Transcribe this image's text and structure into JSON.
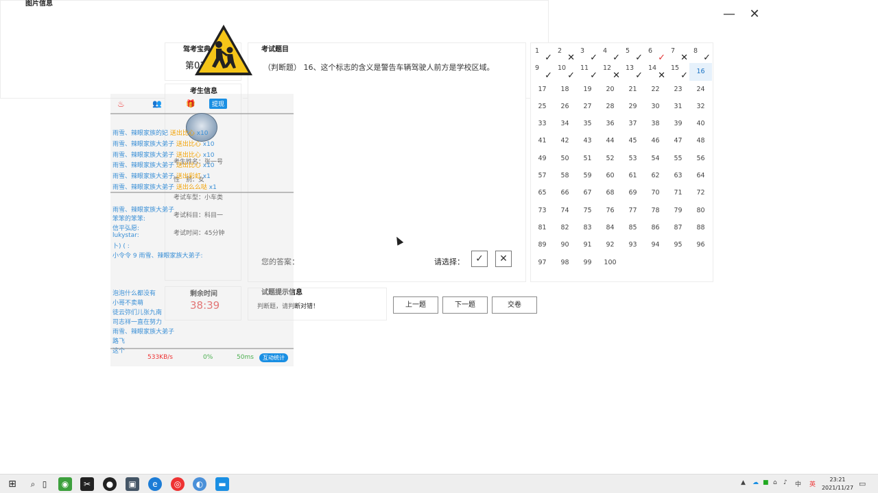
{
  "window": {
    "minimize_glyph": "—",
    "close_glyph": "✕"
  },
  "exam": {
    "venue_title": "驾考宝典考场",
    "seat": "第01考台",
    "student_info_title": "考生信息",
    "student_name_label": "考生姓名：",
    "student_name": "张一号",
    "gender_label": "性　别：",
    "gender": "女",
    "car_type_label": "考试车型：",
    "car_type": "小车类",
    "subject_label": "考试科目：",
    "subject": "科目一",
    "duration_label": "考试时间：",
    "duration": "45分钟",
    "remaining_title": "剩余时间",
    "remaining": "38:39"
  },
  "question": {
    "panel_title": "考试题目",
    "text": "（判断题） 16、这个标志的含义是警告车辆驾驶人前方是学校区域。",
    "your_answer_label": "您的答案：",
    "choose_label": "请选择：",
    "true_glyph": "✓",
    "false_glyph": "✕"
  },
  "hint": {
    "panel_title": "试题提示信息",
    "text": "判断题，请判断对错！"
  },
  "buttons": {
    "prev": "上一题",
    "next": "下一题",
    "submit": "交卷"
  },
  "image_panel": {
    "title": "图片信息",
    "sign": "school-zone-warning-sign"
  },
  "grid": {
    "answered": [
      {
        "n": "1",
        "mark": "✓",
        "color": "#222222"
      },
      {
        "n": "2",
        "mark": "✕",
        "color": "#222222"
      },
      {
        "n": "3",
        "mark": "✓",
        "color": "#222222"
      },
      {
        "n": "4",
        "mark": "✓",
        "color": "#222222"
      },
      {
        "n": "5",
        "mark": "✓",
        "color": "#222222"
      },
      {
        "n": "6",
        "mark": "✓",
        "color": "#e33333"
      },
      {
        "n": "7",
        "mark": "✕",
        "color": "#222222"
      },
      {
        "n": "8",
        "mark": "✓",
        "color": "#222222"
      },
      {
        "n": "9",
        "mark": "✓",
        "color": "#222222"
      },
      {
        "n": "10",
        "mark": "✓",
        "color": "#222222"
      },
      {
        "n": "11",
        "mark": "✓",
        "color": "#222222"
      },
      {
        "n": "12",
        "mark": "✕",
        "color": "#222222"
      },
      {
        "n": "13",
        "mark": "✓",
        "color": "#222222"
      },
      {
        "n": "14",
        "mark": "✕",
        "color": "#222222"
      },
      {
        "n": "15",
        "mark": "✓",
        "color": "#222222"
      }
    ],
    "current": "16",
    "total": 100
  },
  "overlay": {
    "toolbar_withdraw": "提现",
    "gift_lines": [
      {
        "user": "雨雪、辣眼家族的妃",
        "gift": "送出比心",
        "count": "x10"
      },
      {
        "user": "雨雪、辣眼家族大弟子",
        "gift": "送出比心",
        "count": "x10"
      },
      {
        "user": "雨雪、辣眼家族大弟子",
        "gift": "送出比心",
        "count": "x10"
      },
      {
        "user": "雨雪、辣眼家族大弟子",
        "gift": "送出比心",
        "count": "x10"
      },
      {
        "user": "雨雪、辣眼家族大弟子",
        "gift": "送出彩虹",
        "count": "x1"
      },
      {
        "user": "雨雪、辣眼家族大弟子",
        "gift": "送出么么哒",
        "count": "x1"
      }
    ],
    "chat_lines": [
      "雨雪、辣眼家族大弟子",
      "笨笨的笨笨:",
      "信平弘愿:",
      "lukystar:",
      "卜) ( :",
      "小令令  9  雨雪、辣眼家族大弟子:"
    ],
    "chat_lines_2": [
      "泡泡什么都没有",
      "小哥不卖萌",
      "徒云弥们儿张九南",
      "司志祥一直在努力",
      "雨雪、辣眼家族大弟子",
      "路飞",
      "这个"
    ],
    "stats": {
      "speed": "533KB/s",
      "loss": "0%",
      "ping": "50ms",
      "button": "互动统计"
    }
  },
  "taskbar": {
    "clock_time": "23:21",
    "clock_date": "2021/11/27",
    "tray_ime": "中",
    "tray_ime2": "英"
  },
  "colors": {
    "accent": "#1a8fe3",
    "timer": "#e33333",
    "sign_yellow": "#f5c518"
  }
}
